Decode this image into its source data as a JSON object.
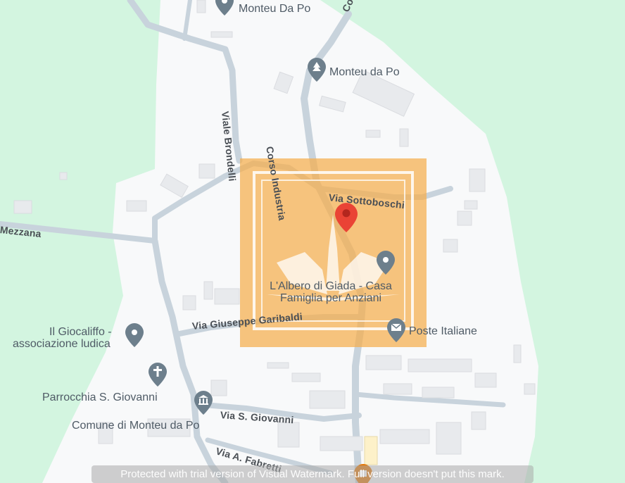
{
  "places": {
    "monteu_top": "Monteu Da Po",
    "monteu_park": "Monteu da Po",
    "albero_line1": "L'Albero di Giada - Casa",
    "albero_line2": "Famiglia per Anziani",
    "poste": "Poste Italiane",
    "giocaliffo_line1": "Il Giocaliffo -",
    "giocaliffo_line2": "associazione ludica",
    "parrocchia": "Parrocchia S. Giovanni",
    "comune": "Comune di Monteu da Po"
  },
  "streets": {
    "corso_top": "Cor",
    "viale_brondelli": "Viale Brondelli",
    "corso_industria": "Corso Industria",
    "via_sottoboschi": "Via Sottoboschi",
    "mezzana": "Mezzana",
    "via_garibaldi": "Via Giuseppe Garibaldi",
    "via_s_giovanni": "Via S. Giovanni",
    "via_fabretti": "Via A. Fabretti"
  },
  "watermark": "Protected with trial version of Visual Watermark. Full version doesn't put this mark.",
  "colors": {
    "park": "#d3f5e0",
    "land": "#f8f9fa",
    "road": "#c8d3dc",
    "highlight": "#f5ad4c",
    "selected_pin": "#ea4335",
    "poi_pin": "#6d7f8c"
  },
  "icons": [
    "pin-icon",
    "tree-icon",
    "mail-icon",
    "cross-icon",
    "building-icon",
    "shopping-icon"
  ]
}
